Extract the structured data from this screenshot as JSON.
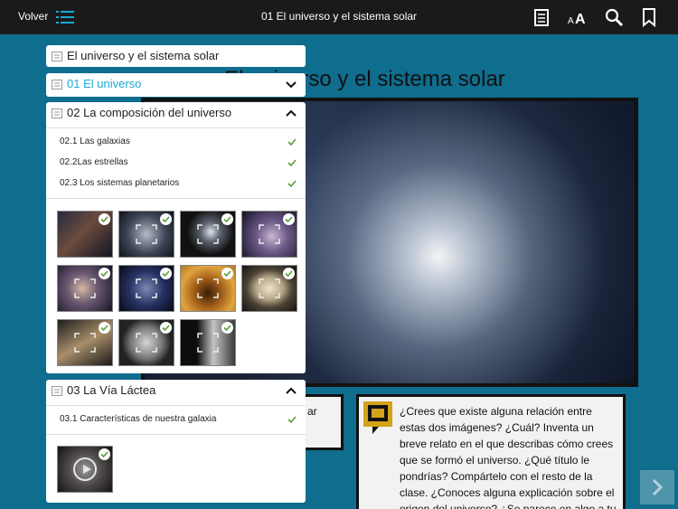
{
  "topbar": {
    "back_label": "Volver",
    "title": "01 El universo y el sistema solar",
    "icons": [
      "toc-icon",
      "notes-icon",
      "font-size-icon",
      "search-icon",
      "bookmark-icon"
    ]
  },
  "page": {
    "heading": "El universo y el sistema solar",
    "left_box_text": "ar",
    "question_text": "¿Crees que existe alguna relación entre estas dos imágenes? ¿Cuál? Inventa un breve relato en el que describas cómo crees que se formó el universo. ¿Qué título le pondrías? Compártelo con el resto de la clase. ¿Conoces alguna explicación sobre el origen del universo? ¿Se parece en algo a tu relato?"
  },
  "toc": {
    "book_title": "El universo y el sistema solar",
    "sections": [
      {
        "label": "01 El universo",
        "active": true,
        "expanded": false
      },
      {
        "label": "02 La composición del universo",
        "active": false,
        "expanded": true,
        "items": [
          "02.1 Las galaxias",
          "02.2Las estrellas",
          "02.3 Los sistemas planetarios"
        ]
      },
      {
        "label": "03 La Vía Láctea",
        "active": false,
        "expanded": true,
        "items": [
          "03.1 Características de nuestra galaxia"
        ]
      }
    ]
  },
  "colors": {
    "accent": "#1aa9d6",
    "check": "#5a9e3a",
    "page_bg": "#0f6d8d",
    "topbar": "#1a1a1a"
  }
}
